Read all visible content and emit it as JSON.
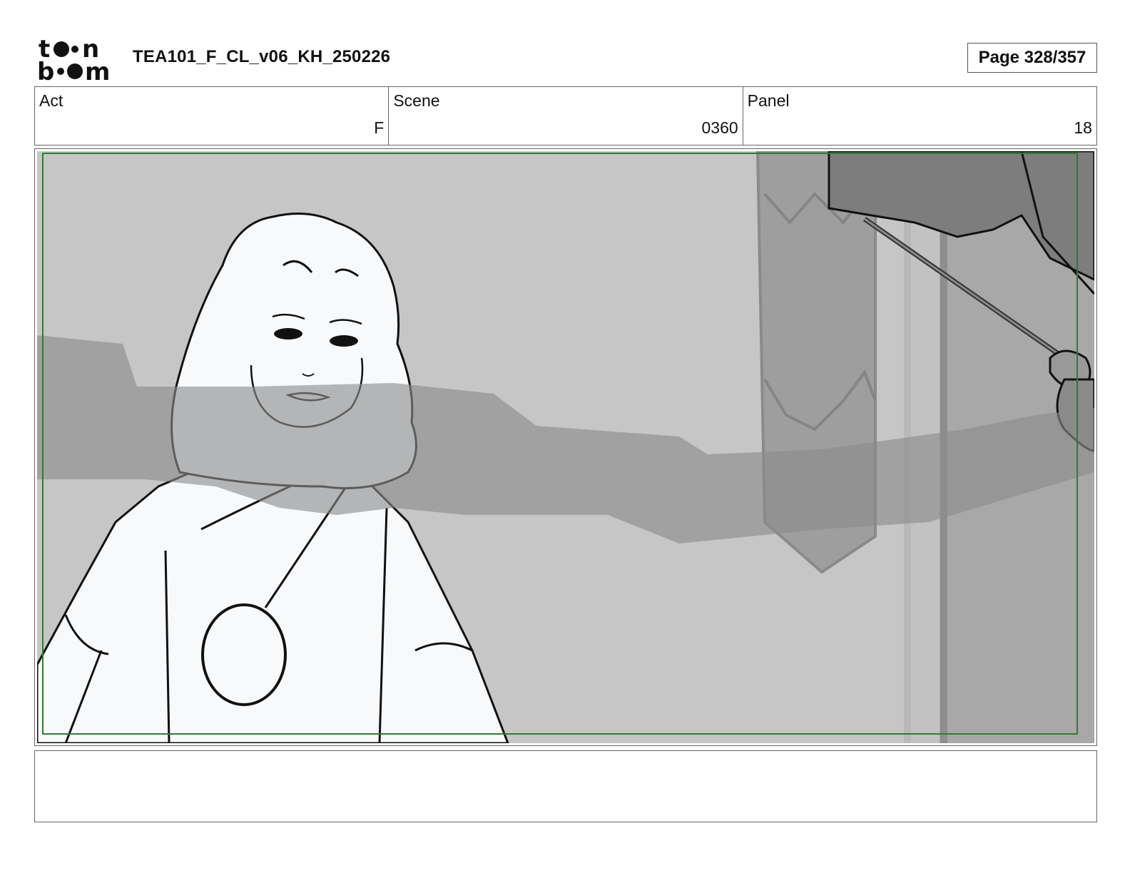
{
  "header": {
    "logo_text": "toon boom",
    "document_title": "TEA101_F_CL_v06_KH_250226",
    "page_label": "Page 328/357"
  },
  "info": {
    "act": {
      "label": "Act",
      "value": "F"
    },
    "scene": {
      "label": "Scene",
      "value": "0360"
    },
    "panel": {
      "label": "Panel",
      "value": "18"
    }
  },
  "panel_image": {
    "description_icon": "storyboard-sketch",
    "safe_frame_color": "#2e7d32"
  },
  "caption": {
    "text": ""
  }
}
